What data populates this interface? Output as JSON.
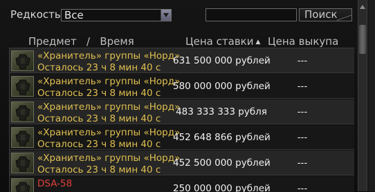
{
  "filter": {
    "rarity_label": "Редкость",
    "rarity_value": "Все",
    "search_value": "",
    "search_button": "Поиск"
  },
  "header": {
    "item_time": "Предмет   /   Время",
    "bid_price": "Цена ставки",
    "buyout_price": "Цена выкупа"
  },
  "rows": [
    {
      "name": "«Хранитель» группы «Норд»",
      "time": "Осталось 23 ч 8 мин 40 с",
      "bid": "631 500 000 рублей",
      "buyout": "---",
      "name_color": "#e0c050"
    },
    {
      "name": "«Хранитель» группы «Норд»",
      "time": "Осталось 23 ч 8 мин 40 с",
      "bid": "580 000 000 рублей",
      "buyout": "---",
      "name_color": "#e0c050"
    },
    {
      "name": "«Хранитель» группы «Норд»",
      "time": "Осталось 23 ч 8 мин 40 с",
      "bid": "483 333 333 рубля",
      "buyout": "---",
      "name_color": "#e0c050"
    },
    {
      "name": "«Хранитель» группы «Норд»",
      "time": "Осталось 23 ч 8 мин 40 с",
      "bid": "452 648 866 рублей",
      "buyout": "---",
      "name_color": "#e0c050"
    },
    {
      "name": "«Хранитель» группы «Норд»",
      "time": "Осталось 23 ч 8 мин 40 с",
      "bid": "452 500 000 рублей",
      "buyout": "---",
      "name_color": "#e0c050"
    },
    {
      "name": "DSA-58",
      "time": "",
      "bid": "250 000 000 рублей",
      "buyout": "---",
      "name_color": "#e0413b"
    }
  ],
  "icons": {
    "row_thumbnail": "armor-suit-icon",
    "rarity_dropdown": "chevron-down-icon",
    "sort": "sort-ascending-icon",
    "scroll_up": "scroll-up-icon"
  },
  "colors": {
    "item_gold": "#e0c050",
    "item_red": "#e0413b",
    "text_white": "#f2f2f2"
  }
}
